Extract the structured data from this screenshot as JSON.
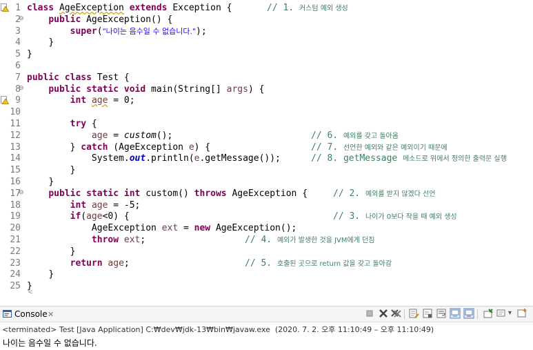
{
  "editor": {
    "lines": [
      {
        "num": "1",
        "fold": "",
        "marker": "warning"
      },
      {
        "num": "2",
        "fold": "⊖",
        "marker": ""
      },
      {
        "num": "3",
        "fold": "",
        "marker": ""
      },
      {
        "num": "4",
        "fold": "",
        "marker": ""
      },
      {
        "num": "5",
        "fold": "",
        "marker": ""
      },
      {
        "num": "6",
        "fold": "",
        "marker": ""
      },
      {
        "num": "7",
        "fold": "",
        "marker": ""
      },
      {
        "num": "8",
        "fold": "⊖",
        "marker": ""
      },
      {
        "num": "9",
        "fold": "",
        "marker": "warning"
      },
      {
        "num": "10",
        "fold": "",
        "marker": ""
      },
      {
        "num": "11",
        "fold": "",
        "marker": ""
      },
      {
        "num": "12",
        "fold": "",
        "marker": ""
      },
      {
        "num": "13",
        "fold": "",
        "marker": ""
      },
      {
        "num": "14",
        "fold": "",
        "marker": ""
      },
      {
        "num": "15",
        "fold": "",
        "marker": ""
      },
      {
        "num": "16",
        "fold": "",
        "marker": ""
      },
      {
        "num": "17",
        "fold": "⊖",
        "marker": ""
      },
      {
        "num": "18",
        "fold": "",
        "marker": ""
      },
      {
        "num": "19",
        "fold": "",
        "marker": ""
      },
      {
        "num": "20",
        "fold": "",
        "marker": ""
      },
      {
        "num": "21",
        "fold": "",
        "marker": ""
      },
      {
        "num": "22",
        "fold": "",
        "marker": ""
      },
      {
        "num": "23",
        "fold": "",
        "marker": ""
      },
      {
        "num": "24",
        "fold": "",
        "marker": ""
      },
      {
        "num": "25",
        "fold": "",
        "marker": ""
      }
    ],
    "tokens": {
      "class": "class",
      "extends": "extends",
      "public": "public",
      "static": "static",
      "void": "void",
      "int": "int",
      "super": "super",
      "try": "try",
      "catch": "catch",
      "throws": "throws",
      "if": "if",
      "new": "new",
      "throw": "throw",
      "return": "return",
      "AgeException": "AgeException",
      "Exception_open": " Exception {",
      "AgeException_ctor": " AgeException() {",
      "paren_open": "(",
      "super_msg": "\"나이는 음수일 수 없습니다.\"",
      "close_paren_semi": ");",
      "brace_close": "}",
      "Test_open": " Test {",
      "main_sig": " main(String[] ",
      "args": "args",
      "main_close": ") {",
      "age": "age",
      "assign_zero": " = 0;",
      "brace_open": " {",
      "assign": " = ",
      "custom_call": "custom",
      "call_close": "();",
      "catch_open": " (AgeException ",
      "e": "e",
      "catch_close": ") {",
      "system": "System.",
      "out": "out",
      "println": ".println(",
      "getmsg": ".getMessage());",
      "custom_sig": " custom() ",
      "throws_tail": " AgeException {",
      "assign_neg": " = -5;",
      "if_open": "(",
      "if_cond": "<0) {",
      "ageexc_decl": "AgeException ",
      "ext": "ext",
      "new_tail": " AgeException();",
      "semi": ";",
      "space": " "
    },
    "comments": {
      "c1": {
        "prefix": "// 1. ",
        "korean": "커스텀 예외 생성"
      },
      "c6": {
        "prefix": "// 6. ",
        "korean": "예외를 갖고 돌아옴"
      },
      "c7": {
        "prefix": "// 7. ",
        "korean": "선언한 예외와 같은 예외이기 때문에"
      },
      "c8": {
        "prefix": "// 8. getMessage ",
        "korean": "메소드로 위에서 정의한 출력문 실행"
      },
      "c2": {
        "prefix": "// 2. ",
        "korean": "예외를 받지 않겠다 선언"
      },
      "c3": {
        "prefix": "// 3. ",
        "korean": "나이가 0보다 작을 때 예외 생성"
      },
      "c4": {
        "prefix": "// 4. ",
        "korean": "예외가 발생한 것을 JVM에게 던짐"
      },
      "c5": {
        "prefix": "// 5. ",
        "korean": "호출된 곳으로 return 값을 갖고 돌아감"
      }
    }
  },
  "hscroll": {
    "arrow": "<"
  },
  "console": {
    "tab_label": "Console",
    "close_glyph": "✕",
    "terminated_text": "<terminated> Test [Java Application] C:₩dev₩jdk-13₩bin₩javaw.exe  (2020. 7. 2. 오후 11:10:49 – 오후 11:10:49)",
    "output_text": "나이는 음수일 수 없습니다."
  },
  "colors": {
    "keyword": "#7f0055",
    "string": "#2a00ff",
    "comment": "#3f7f5f",
    "local_var": "#6a3e3e",
    "field": "#0000c0"
  }
}
